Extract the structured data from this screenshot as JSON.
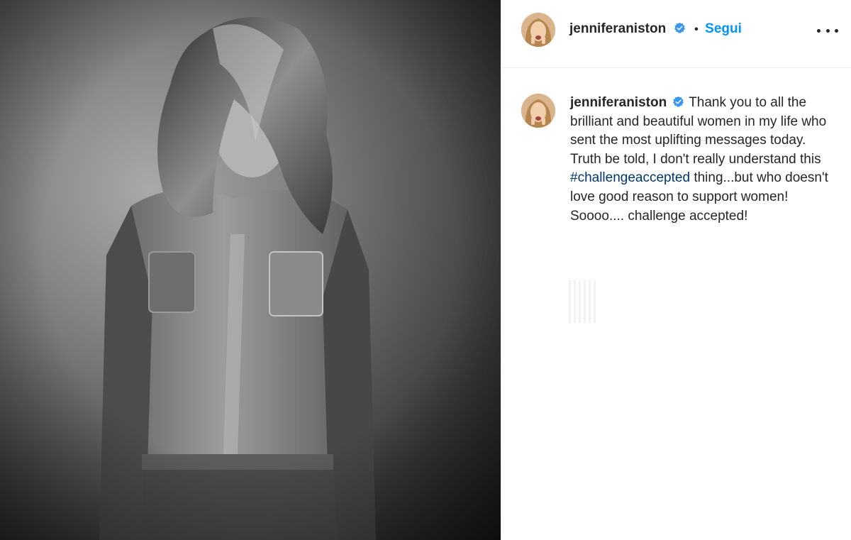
{
  "post": {
    "image_alt": "Black and white portrait of a woman with long tousled hair covering her face, wearing a denim shirt and jeans"
  },
  "header": {
    "username": "jenniferaniston",
    "separator": "•",
    "follow_label": "Segui",
    "more_icon": "more-options-icon"
  },
  "caption": {
    "username": "jenniferaniston",
    "text_before": "Thank you to all the brilliant and beautiful women in my life who sent the most uplifting messages today. Truth be told, I don't really understand this",
    "hashtag": "#challengeaccepted",
    "text_after": "thing...but who doesn't love good reason to support women!  Soooo.... challenge accepted!"
  },
  "colors": {
    "verified": "#3897f0",
    "follow": "#0095f6",
    "hashtag": "#00376b"
  }
}
